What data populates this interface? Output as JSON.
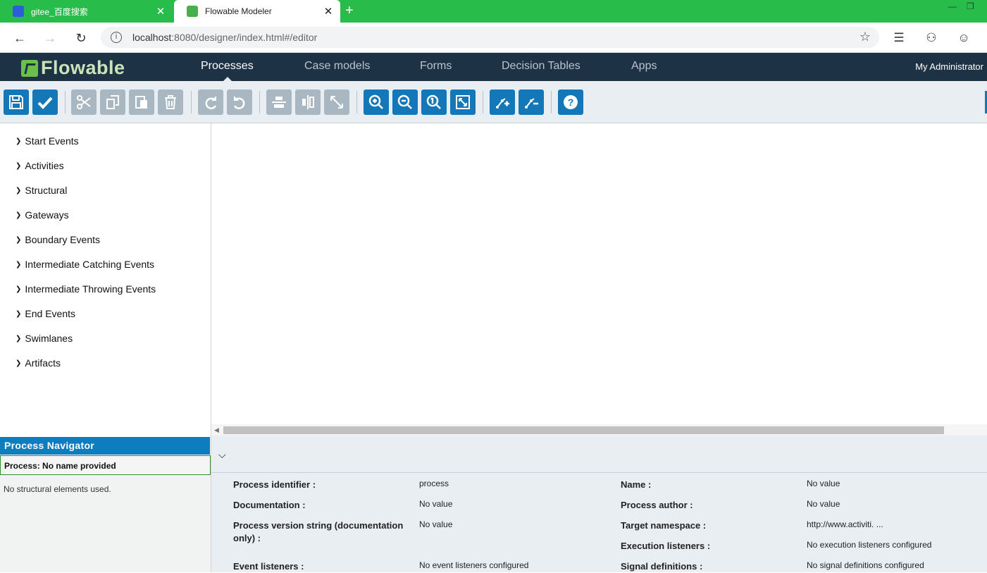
{
  "browser": {
    "tabs": [
      {
        "title": "gitee_百度搜索",
        "active": false
      },
      {
        "title": "Flowable Modeler",
        "active": true
      }
    ],
    "url_host": "localhost",
    "url_rest": ":8080/designer/index.html#/editor"
  },
  "app": {
    "brand": "Flowable",
    "nav": [
      {
        "label": "Processes",
        "active": true
      },
      {
        "label": "Case models",
        "active": false
      },
      {
        "label": "Forms",
        "active": false
      },
      {
        "label": "Decision Tables",
        "active": false
      },
      {
        "label": "Apps",
        "active": false
      }
    ],
    "user": "My Administrator"
  },
  "toolbar": {
    "buttons": [
      {
        "name": "save",
        "icon": "save-icon",
        "enabled": true
      },
      {
        "name": "validate",
        "icon": "check-icon",
        "enabled": true
      },
      {
        "name": "cut",
        "icon": "scissors-icon",
        "enabled": false
      },
      {
        "name": "copy",
        "icon": "copy-icon",
        "enabled": false
      },
      {
        "name": "paste",
        "icon": "paste-icon",
        "enabled": false
      },
      {
        "name": "delete",
        "icon": "trash-icon",
        "enabled": false
      },
      {
        "name": "redo",
        "icon": "redo-icon",
        "enabled": false
      },
      {
        "name": "undo",
        "icon": "undo-icon",
        "enabled": false
      },
      {
        "name": "align-horizontal",
        "icon": "align-horizontal-icon",
        "enabled": false
      },
      {
        "name": "align-vertical",
        "icon": "align-vertical-icon",
        "enabled": false
      },
      {
        "name": "same-size",
        "icon": "resize-icon",
        "enabled": false
      },
      {
        "name": "zoom-in",
        "icon": "zoom-in-icon",
        "enabled": true
      },
      {
        "name": "zoom-out",
        "icon": "zoom-out-icon",
        "enabled": true
      },
      {
        "name": "zoom-actual",
        "icon": "zoom-actual-icon",
        "enabled": true
      },
      {
        "name": "zoom-fit",
        "icon": "zoom-fit-icon",
        "enabled": true
      },
      {
        "name": "add-bendpoint",
        "icon": "add-bendpoint-icon",
        "enabled": true
      },
      {
        "name": "remove-bendpoint",
        "icon": "remove-bendpoint-icon",
        "enabled": true
      },
      {
        "name": "help",
        "icon": "help-icon",
        "enabled": true
      }
    ]
  },
  "palette": {
    "groups": [
      "Start Events",
      "Activities",
      "Structural",
      "Gateways",
      "Boundary Events",
      "Intermediate Catching Events",
      "Intermediate Throwing Events",
      "End Events",
      "Swimlanes",
      "Artifacts"
    ]
  },
  "navigator": {
    "title": "Process Navigator",
    "process": "Process: No name provided",
    "empty": "No structural elements used."
  },
  "properties": {
    "left": [
      {
        "label": "Process identifier :",
        "value": "process"
      },
      {
        "label": "Documentation :",
        "value": "No value"
      },
      {
        "label": "Process version string (documentation only) :",
        "value": "No value"
      },
      {
        "label": "Event listeners :",
        "value": "No event listeners configured"
      }
    ],
    "right": [
      {
        "label": "Name :",
        "value": "No value"
      },
      {
        "label": "Process author :",
        "value": "No value"
      },
      {
        "label": "Target namespace :",
        "value": "http://www.activiti. ..."
      },
      {
        "label": "Execution listeners :",
        "value": "No execution listeners configured"
      },
      {
        "label": "Signal definitions :",
        "value": "No signal definitions configured"
      }
    ]
  },
  "colors": {
    "tabstrip": "#28bd4a",
    "header": "#1e3246",
    "accent": "#1377b8",
    "toolbar": "#e9eef3"
  }
}
